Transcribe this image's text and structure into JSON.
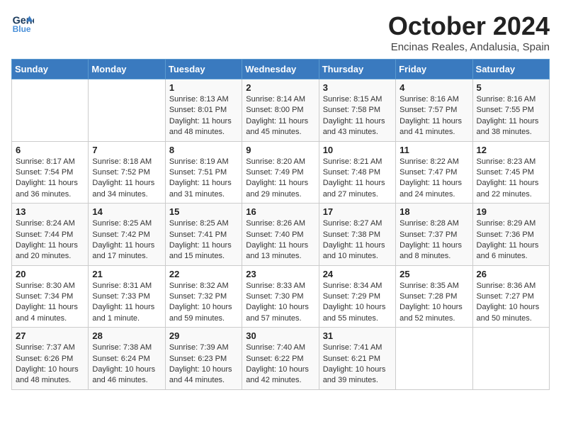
{
  "header": {
    "logo_line1": "General",
    "logo_line2": "Blue",
    "month": "October 2024",
    "location": "Encinas Reales, Andalusia, Spain"
  },
  "days_of_week": [
    "Sunday",
    "Monday",
    "Tuesday",
    "Wednesday",
    "Thursday",
    "Friday",
    "Saturday"
  ],
  "weeks": [
    [
      {
        "day": "",
        "content": ""
      },
      {
        "day": "",
        "content": ""
      },
      {
        "day": "1",
        "content": "Sunrise: 8:13 AM\nSunset: 8:01 PM\nDaylight: 11 hours and 48 minutes."
      },
      {
        "day": "2",
        "content": "Sunrise: 8:14 AM\nSunset: 8:00 PM\nDaylight: 11 hours and 45 minutes."
      },
      {
        "day": "3",
        "content": "Sunrise: 8:15 AM\nSunset: 7:58 PM\nDaylight: 11 hours and 43 minutes."
      },
      {
        "day": "4",
        "content": "Sunrise: 8:16 AM\nSunset: 7:57 PM\nDaylight: 11 hours and 41 minutes."
      },
      {
        "day": "5",
        "content": "Sunrise: 8:16 AM\nSunset: 7:55 PM\nDaylight: 11 hours and 38 minutes."
      }
    ],
    [
      {
        "day": "6",
        "content": "Sunrise: 8:17 AM\nSunset: 7:54 PM\nDaylight: 11 hours and 36 minutes."
      },
      {
        "day": "7",
        "content": "Sunrise: 8:18 AM\nSunset: 7:52 PM\nDaylight: 11 hours and 34 minutes."
      },
      {
        "day": "8",
        "content": "Sunrise: 8:19 AM\nSunset: 7:51 PM\nDaylight: 11 hours and 31 minutes."
      },
      {
        "day": "9",
        "content": "Sunrise: 8:20 AM\nSunset: 7:49 PM\nDaylight: 11 hours and 29 minutes."
      },
      {
        "day": "10",
        "content": "Sunrise: 8:21 AM\nSunset: 7:48 PM\nDaylight: 11 hours and 27 minutes."
      },
      {
        "day": "11",
        "content": "Sunrise: 8:22 AM\nSunset: 7:47 PM\nDaylight: 11 hours and 24 minutes."
      },
      {
        "day": "12",
        "content": "Sunrise: 8:23 AM\nSunset: 7:45 PM\nDaylight: 11 hours and 22 minutes."
      }
    ],
    [
      {
        "day": "13",
        "content": "Sunrise: 8:24 AM\nSunset: 7:44 PM\nDaylight: 11 hours and 20 minutes."
      },
      {
        "day": "14",
        "content": "Sunrise: 8:25 AM\nSunset: 7:42 PM\nDaylight: 11 hours and 17 minutes."
      },
      {
        "day": "15",
        "content": "Sunrise: 8:25 AM\nSunset: 7:41 PM\nDaylight: 11 hours and 15 minutes."
      },
      {
        "day": "16",
        "content": "Sunrise: 8:26 AM\nSunset: 7:40 PM\nDaylight: 11 hours and 13 minutes."
      },
      {
        "day": "17",
        "content": "Sunrise: 8:27 AM\nSunset: 7:38 PM\nDaylight: 11 hours and 10 minutes."
      },
      {
        "day": "18",
        "content": "Sunrise: 8:28 AM\nSunset: 7:37 PM\nDaylight: 11 hours and 8 minutes."
      },
      {
        "day": "19",
        "content": "Sunrise: 8:29 AM\nSunset: 7:36 PM\nDaylight: 11 hours and 6 minutes."
      }
    ],
    [
      {
        "day": "20",
        "content": "Sunrise: 8:30 AM\nSunset: 7:34 PM\nDaylight: 11 hours and 4 minutes."
      },
      {
        "day": "21",
        "content": "Sunrise: 8:31 AM\nSunset: 7:33 PM\nDaylight: 11 hours and 1 minute."
      },
      {
        "day": "22",
        "content": "Sunrise: 8:32 AM\nSunset: 7:32 PM\nDaylight: 10 hours and 59 minutes."
      },
      {
        "day": "23",
        "content": "Sunrise: 8:33 AM\nSunset: 7:30 PM\nDaylight: 10 hours and 57 minutes."
      },
      {
        "day": "24",
        "content": "Sunrise: 8:34 AM\nSunset: 7:29 PM\nDaylight: 10 hours and 55 minutes."
      },
      {
        "day": "25",
        "content": "Sunrise: 8:35 AM\nSunset: 7:28 PM\nDaylight: 10 hours and 52 minutes."
      },
      {
        "day": "26",
        "content": "Sunrise: 8:36 AM\nSunset: 7:27 PM\nDaylight: 10 hours and 50 minutes."
      }
    ],
    [
      {
        "day": "27",
        "content": "Sunrise: 7:37 AM\nSunset: 6:26 PM\nDaylight: 10 hours and 48 minutes."
      },
      {
        "day": "28",
        "content": "Sunrise: 7:38 AM\nSunset: 6:24 PM\nDaylight: 10 hours and 46 minutes."
      },
      {
        "day": "29",
        "content": "Sunrise: 7:39 AM\nSunset: 6:23 PM\nDaylight: 10 hours and 44 minutes."
      },
      {
        "day": "30",
        "content": "Sunrise: 7:40 AM\nSunset: 6:22 PM\nDaylight: 10 hours and 42 minutes."
      },
      {
        "day": "31",
        "content": "Sunrise: 7:41 AM\nSunset: 6:21 PM\nDaylight: 10 hours and 39 minutes."
      },
      {
        "day": "",
        "content": ""
      },
      {
        "day": "",
        "content": ""
      }
    ]
  ]
}
